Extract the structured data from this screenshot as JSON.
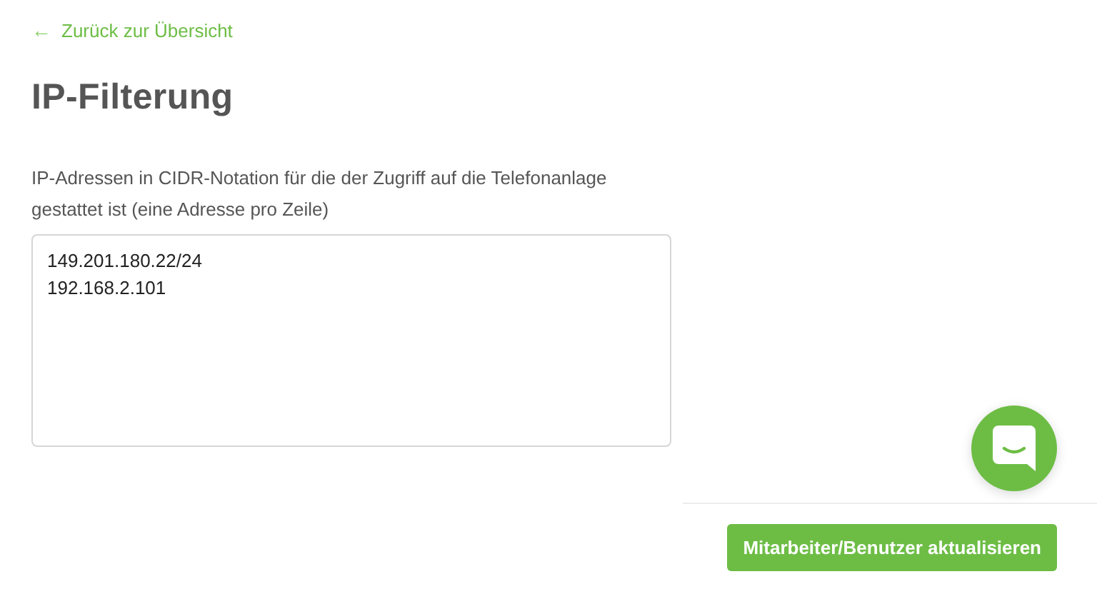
{
  "back_link": {
    "arrow": "←",
    "label": "Zurück zur Übersicht"
  },
  "title": "IP-Filterung",
  "field": {
    "label": "IP-Adressen in CIDR-Notation für die der Zugriff auf die Telefonanlage gestattet ist (eine Adresse pro Zeile)",
    "value": "149.201.180.22/24\n192.168.2.101"
  },
  "submit_button": {
    "label": "Mitarbeiter/Benutzer aktualisieren"
  }
}
